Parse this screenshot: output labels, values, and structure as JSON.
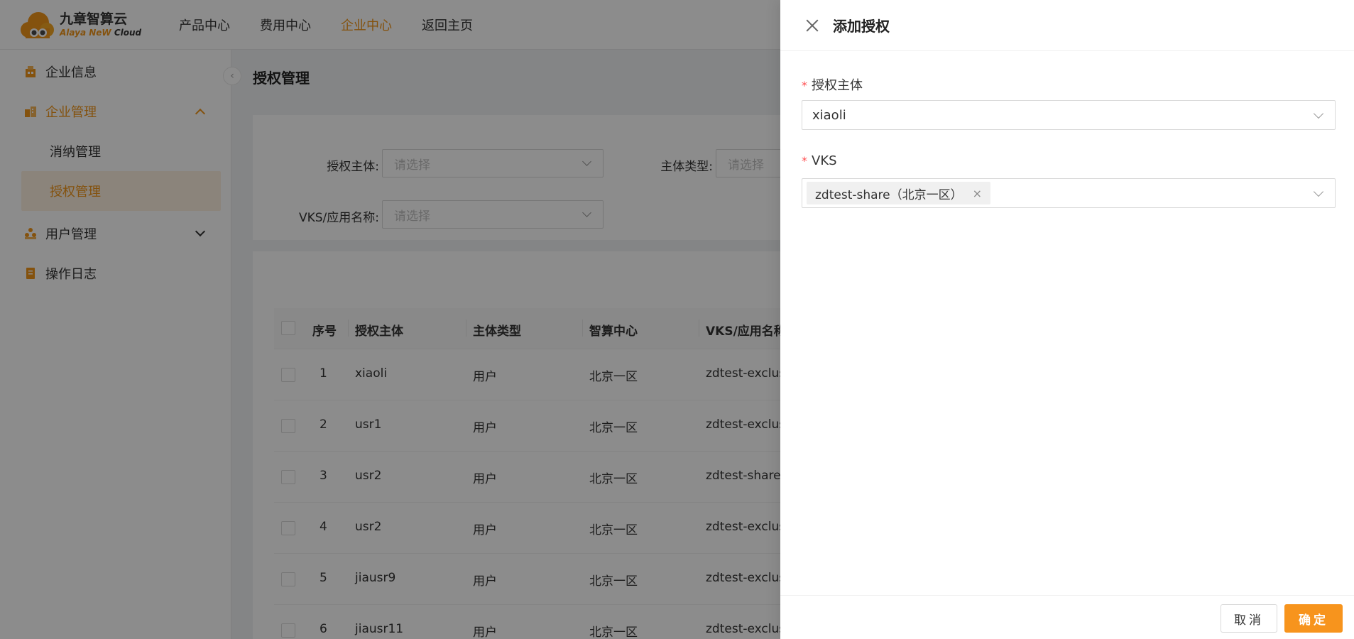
{
  "header": {
    "logo_cn": "九章智算云",
    "logo_en": "Alaya NeW",
    "logo_en_suffix": "Cloud",
    "nav": [
      "产品中心",
      "费用中心",
      "企业中心",
      "返回主页"
    ],
    "active_nav_index": 2
  },
  "sidebar": {
    "items": [
      {
        "label": "企业信息",
        "icon": "building-icon"
      },
      {
        "label": "企业管理",
        "icon": "enterprise-icon",
        "expanded": true
      },
      {
        "label": "消纳管理",
        "sub": true
      },
      {
        "label": "授权管理",
        "sub": true,
        "selected": true
      },
      {
        "label": "用户管理",
        "icon": "users-icon",
        "expanded": false
      },
      {
        "label": "操作日志",
        "icon": "log-icon"
      }
    ]
  },
  "main": {
    "title": "授权管理",
    "filters": {
      "subject_label": "授权主体:",
      "subject_placeholder": "请选择",
      "type_label": "主体类型:",
      "type_placeholder": "请选择",
      "vks_label": "VKS/应用名称:",
      "vks_placeholder": "请选择"
    },
    "table": {
      "columns": [
        "序号",
        "授权主体",
        "主体类型",
        "智算中心",
        "VKS/应用名称"
      ],
      "rows": [
        [
          "1",
          "xiaoli",
          "用户",
          "北京一区",
          "zdtest-exclus"
        ],
        [
          "2",
          "usr1",
          "用户",
          "北京一区",
          "zdtest-exclus"
        ],
        [
          "3",
          "usr2",
          "用户",
          "北京一区",
          "zdtest-share"
        ],
        [
          "4",
          "usr2",
          "用户",
          "北京一区",
          "zdtest-exclus"
        ],
        [
          "5",
          "jiausr9",
          "用户",
          "北京一区",
          "zdtest-exclus"
        ],
        [
          "6",
          "jiausr11",
          "用户",
          "北京一区",
          "zdtest-exclus"
        ]
      ]
    }
  },
  "drawer": {
    "title": "添加授权",
    "subject_label": "授权主体",
    "subject_value": "xiaoli",
    "vks_label": "VKS",
    "vks_tag": "zdtest-share（北京一区）",
    "tag_remove": "×",
    "required_mark": "*",
    "cancel_label": "取消",
    "ok_label": "确定"
  },
  "colors": {
    "accent": "#f7941d",
    "active_text": "#f0951a",
    "selected_bg": "#fdf0e1",
    "required": "#ff4d4f"
  }
}
